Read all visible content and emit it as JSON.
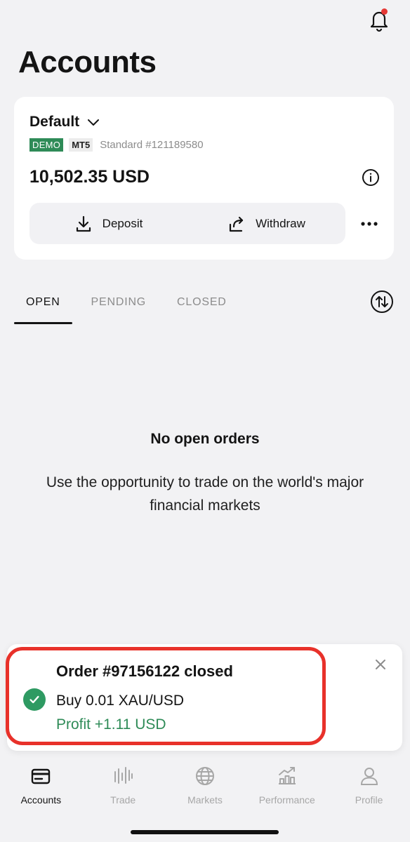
{
  "header": {
    "title": "Accounts",
    "notification_icon": "bell-icon",
    "notification_dot_color": "#e53935"
  },
  "account": {
    "name": "Default",
    "badge_demo": "DEMO",
    "badge_platform": "MT5",
    "type_label": "Standard #121189580",
    "balance": "10,502.35 USD",
    "deposit_label": "Deposit",
    "withdraw_label": "Withdraw",
    "icons": [
      "chevron-down-icon",
      "info-icon",
      "download-icon",
      "share-icon",
      "more-icon"
    ]
  },
  "tabs": [
    {
      "label": "OPEN",
      "active": true
    },
    {
      "label": "PENDING",
      "active": false
    },
    {
      "label": "CLOSED",
      "active": false
    }
  ],
  "empty_state": {
    "title": "No open orders",
    "text": "Use the opportunity to trade on the world's major financial markets"
  },
  "toast": {
    "title": "Order #97156122 closed",
    "order": "Buy 0.01 XAU/USD",
    "profit": "Profit +1.11 USD",
    "profit_color": "#2e8b57",
    "highlight_color": "#e8312a"
  },
  "bottom_nav": [
    {
      "label": "Accounts",
      "icon": "accounts-icon",
      "active": true
    },
    {
      "label": "Trade",
      "icon": "trade-icon",
      "active": false
    },
    {
      "label": "Markets",
      "icon": "globe-icon",
      "active": false
    },
    {
      "label": "Performance",
      "icon": "performance-icon",
      "active": false
    },
    {
      "label": "Profile",
      "icon": "profile-icon",
      "active": false
    }
  ]
}
